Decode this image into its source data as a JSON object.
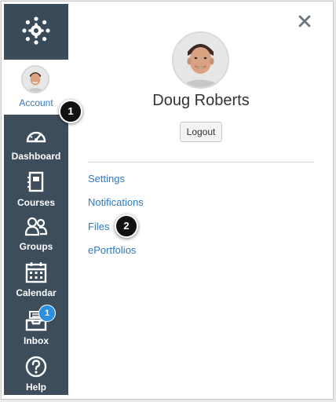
{
  "colors": {
    "nav_background": "#3d4d5c",
    "link": "#2d7ac1",
    "badge": "#2d8fe0",
    "callout": "#111111"
  },
  "nav": {
    "logo_icon": "canvas-logo-icon",
    "account_label": "Account",
    "items": [
      {
        "label": "Dashboard",
        "icon": "dashboard-icon"
      },
      {
        "label": "Courses",
        "icon": "courses-icon"
      },
      {
        "label": "Groups",
        "icon": "groups-icon"
      },
      {
        "label": "Calendar",
        "icon": "calendar-icon"
      },
      {
        "label": "Inbox",
        "icon": "inbox-icon",
        "badge": "1"
      },
      {
        "label": "Help",
        "icon": "help-icon"
      }
    ]
  },
  "tray": {
    "close_icon": "close-icon",
    "user_name": "Doug Roberts",
    "logout_label": "Logout",
    "links": [
      "Settings",
      "Notifications",
      "Files",
      "ePortfolios"
    ]
  },
  "callouts": [
    "1",
    "2"
  ]
}
